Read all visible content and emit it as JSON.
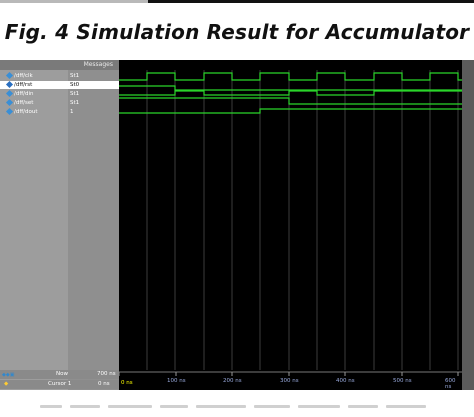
{
  "caption": "Fig. 4 Simulation Result for Accumulator",
  "wave_window": {
    "header": "Messages",
    "signals": [
      {
        "name": "/dff/clk",
        "value": "St1"
      },
      {
        "name": "/dff/rst",
        "value": "St0"
      },
      {
        "name": "/dff/din",
        "value": "St1"
      },
      {
        "name": "/dff/set",
        "value": "St1"
      },
      {
        "name": "/dff/dout",
        "value": "1"
      }
    ],
    "now_label": "Now",
    "now_value": "700 ns",
    "cursor_label": "Cursor 1",
    "cursor_value": "0 ns",
    "cursor_tag": "0 ns",
    "time_ticks": [
      "100 ns",
      "200 ns",
      "300 ns",
      "400 ns",
      "500 ns",
      "600 ns"
    ]
  },
  "colors": {
    "wave": "#2bd52b",
    "background": "#000000",
    "grid": "#3d3d3d"
  }
}
